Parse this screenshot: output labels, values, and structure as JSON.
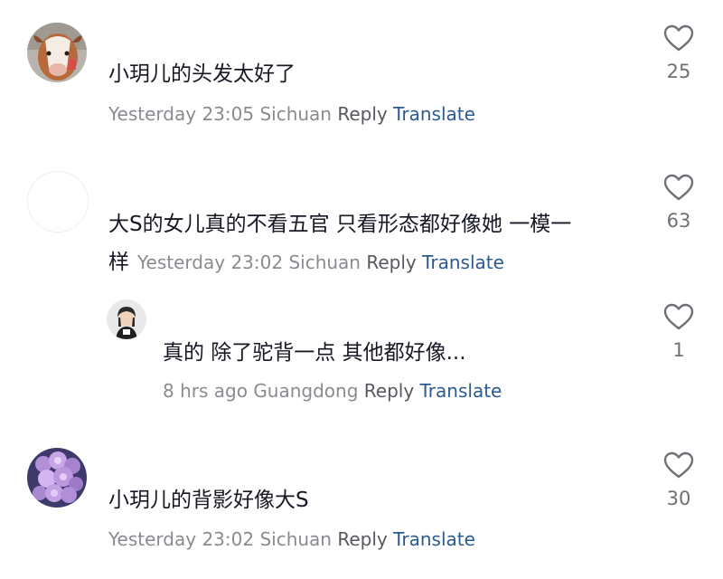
{
  "comments": [
    {
      "text": "小玥儿的头发太好了",
      "time": "Yesterday 23:05",
      "location": "Sichuan",
      "reply": "Reply",
      "translate": "Translate",
      "likes": "25",
      "avatar_icon": "calf-photo-avatar"
    },
    {
      "text_line1": "大S的女儿真的不看五官 只看形态都好像她 一模一",
      "text_line2": "样",
      "time": "Yesterday 23:02",
      "location": "Sichuan",
      "reply": "Reply",
      "translate": "Translate",
      "likes": "63",
      "avatar_icon": "blank-avatar"
    },
    {
      "text": "真的 除了驼背一点 其他都好像...",
      "time": "8 hrs ago",
      "location": "Guangdong",
      "reply": "Reply",
      "translate": "Translate",
      "likes": "1",
      "avatar_icon": "person-avatar"
    },
    {
      "text": "小玥儿的背影好像大S",
      "time": "Yesterday 23:02",
      "location": "Sichuan",
      "reply": "Reply",
      "translate": "Translate",
      "likes": "30",
      "avatar_icon": "flower-bouquet-avatar"
    }
  ],
  "colors": {
    "text": "#161823",
    "meta": "#8a8b91",
    "reply": "#57585f",
    "translate": "#2b5a8f",
    "like_icon": "#6f7077"
  }
}
